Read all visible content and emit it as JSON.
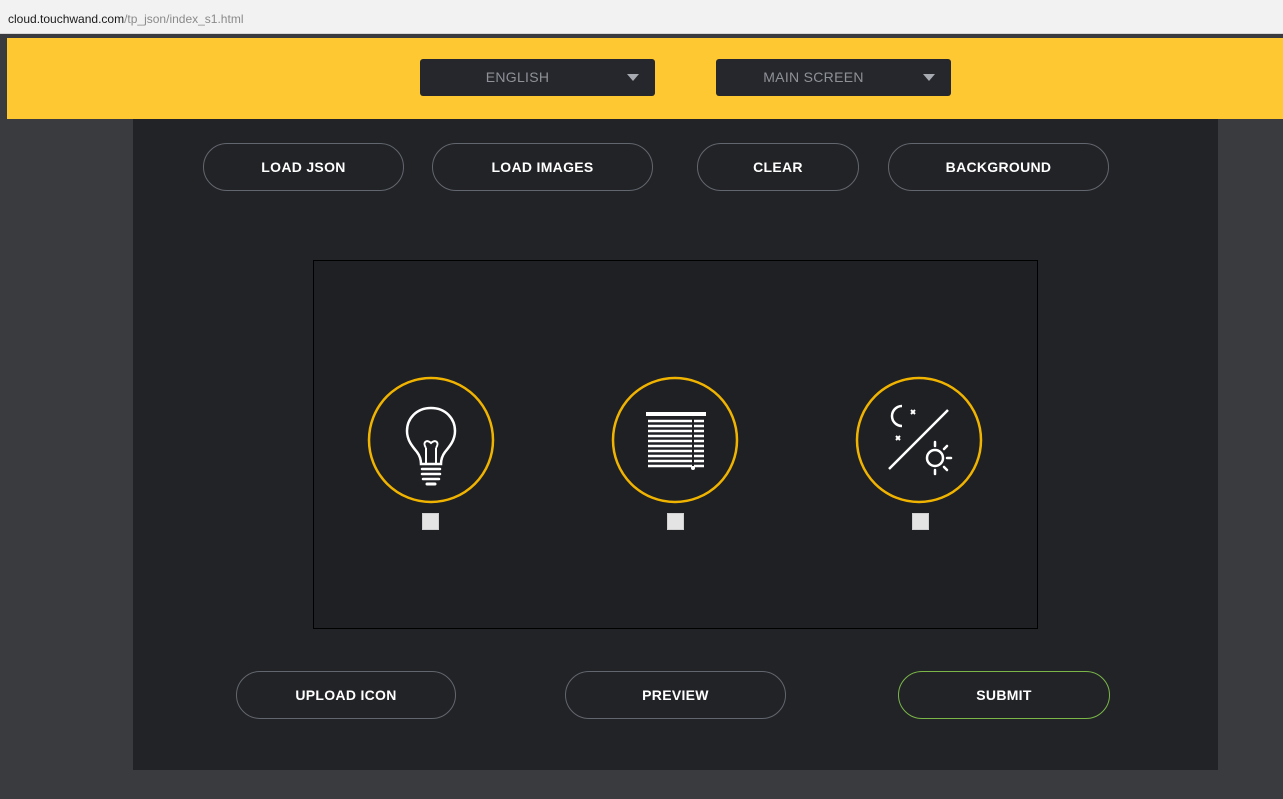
{
  "address_bar": {
    "host": "cloud.touchwand.com",
    "path": "/tp_json/index_s1.html"
  },
  "header": {
    "language_select": {
      "value": "ENGLISH"
    },
    "screen_select": {
      "value": "MAIN SCREEN"
    }
  },
  "toolbar": {
    "load_json": "LOAD JSON",
    "load_images": "LOAD IMAGES",
    "clear": "CLEAR",
    "background": "BACKGROUND"
  },
  "canvas": {
    "devices": [
      {
        "icon": "light-bulb-icon",
        "checked": false
      },
      {
        "icon": "window-blinds-icon",
        "checked": false
      },
      {
        "icon": "day-night-icon",
        "checked": false
      }
    ],
    "ring_color": "#f0b400"
  },
  "footer": {
    "upload_icon": "UPLOAD ICON",
    "preview": "PREVIEW",
    "submit": "SUBMIT"
  },
  "colors": {
    "accent": "#fec832",
    "panel": "#222327",
    "submit_border": "#7ab648"
  }
}
